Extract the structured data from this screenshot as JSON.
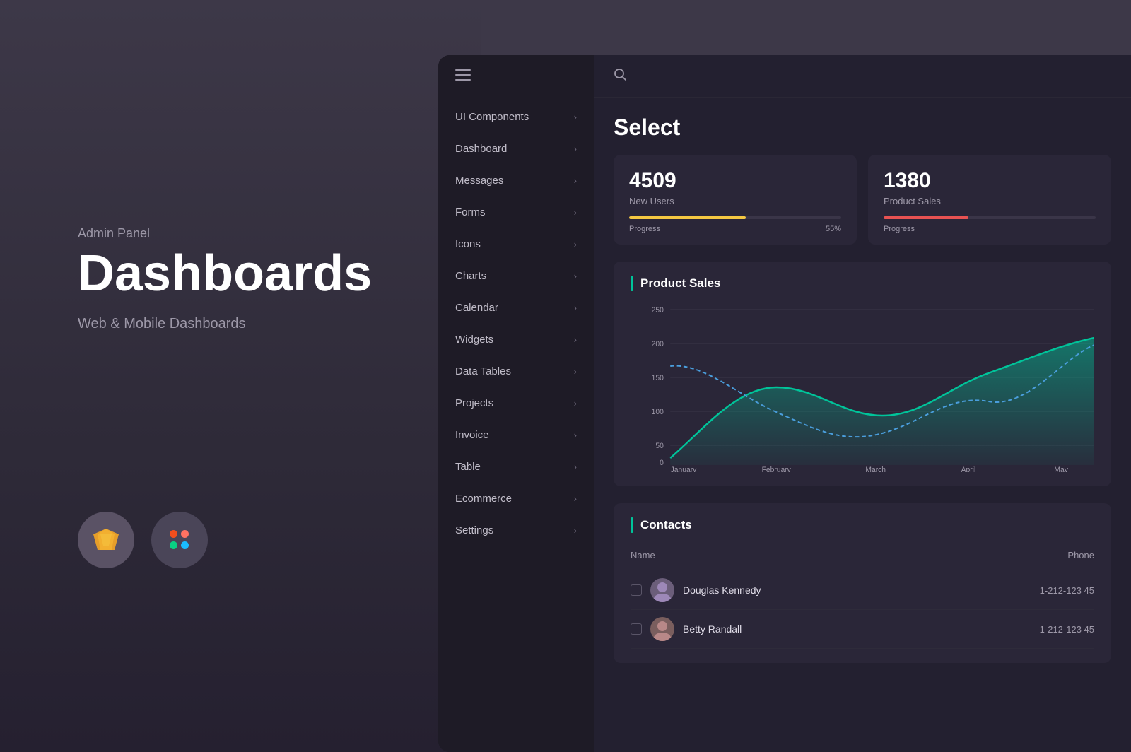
{
  "page": {
    "background_color": "#3d3848"
  },
  "left_panel": {
    "admin_label": "Admin Panel",
    "title": "Dashboards",
    "subtitle": "Web & Mobile Dashboards"
  },
  "header": {
    "search_placeholder": "Search..."
  },
  "select_title": "Select",
  "stats": [
    {
      "id": "new-users",
      "number": "4509",
      "label": "New Users",
      "progress_pct": "55%",
      "progress_width": "55",
      "progress_label": "Progress",
      "color": "yellow"
    },
    {
      "id": "product-sales",
      "number": "1380",
      "label": "Product Sales",
      "progress_pct": "40%",
      "progress_width": "40",
      "progress_label": "Progress",
      "color": "red"
    }
  ],
  "chart": {
    "title": "Product Sales",
    "x_labels": [
      "January",
      "February",
      "March",
      "April",
      "May"
    ],
    "y_labels": [
      "0",
      "50",
      "100",
      "150",
      "200",
      "250"
    ],
    "accent_color": "#00c49a"
  },
  "contacts": {
    "title": "Contacts",
    "accent_color": "#00c49a",
    "columns": [
      "Name",
      "Phone"
    ],
    "rows": [
      {
        "name": "Douglas Kennedy",
        "phone": "1-212-123 45",
        "avatar_bg": "#6b5e7a"
      },
      {
        "name": "Betty Randall",
        "phone": "1-212-123 45",
        "avatar_bg": "#7a5e5e"
      }
    ]
  },
  "sidebar": {
    "items": [
      {
        "label": "UI Components",
        "id": "ui-components"
      },
      {
        "label": "Dashboard",
        "id": "dashboard"
      },
      {
        "label": "Messages",
        "id": "messages"
      },
      {
        "label": "Forms",
        "id": "forms"
      },
      {
        "label": "Icons",
        "id": "icons"
      },
      {
        "label": "Charts",
        "id": "charts"
      },
      {
        "label": "Calendar",
        "id": "calendar"
      },
      {
        "label": "Widgets",
        "id": "widgets"
      },
      {
        "label": "Data Tables",
        "id": "data-tables"
      },
      {
        "label": "Projects",
        "id": "projects"
      },
      {
        "label": "Invoice",
        "id": "invoice"
      },
      {
        "label": "Table",
        "id": "table"
      },
      {
        "label": "Ecommerce",
        "id": "ecommerce"
      },
      {
        "label": "Settings",
        "id": "settings"
      }
    ]
  },
  "icons": {
    "hamburger": "☰",
    "search": "🔍",
    "chevron": "›"
  }
}
